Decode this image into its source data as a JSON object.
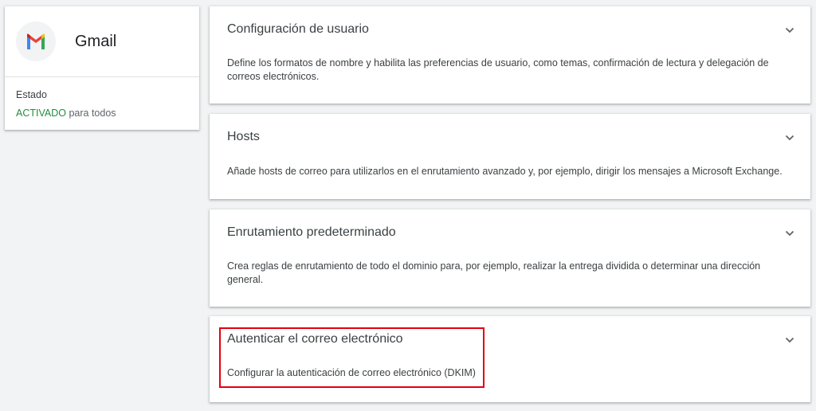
{
  "app": {
    "name": "Gmail",
    "logo_icon": "gmail-logo-icon",
    "status_label": "Estado",
    "status_value": "ACTIVADO",
    "status_suffix": " para todos",
    "status_color": "#1e8e3e"
  },
  "panels": [
    {
      "title": "Configuración de usuario",
      "description": "Define los formatos de nombre y habilita las preferencias de usuario, como temas, confirmación de lectura y delegación de correos electrónicos.",
      "icon": "chevron-down-icon"
    },
    {
      "title": "Hosts",
      "description": "Añade hosts de correo para utilizarlos en el enrutamiento avanzado y, por ejemplo, dirigir los mensajes a Microsoft Exchange.",
      "icon": "chevron-down-icon"
    },
    {
      "title": "Enrutamiento predeterminado",
      "description": "Crea reglas de enrutamiento de todo el dominio para, por ejemplo, realizar la entrega dividida o determinar una dirección general.",
      "icon": "chevron-down-icon"
    },
    {
      "title": "Autenticar el correo electrónico",
      "description": "Configurar la autenticación de correo electrónico (DKIM)",
      "icon": "chevron-down-icon"
    }
  ],
  "highlight_color": "#e3000f"
}
